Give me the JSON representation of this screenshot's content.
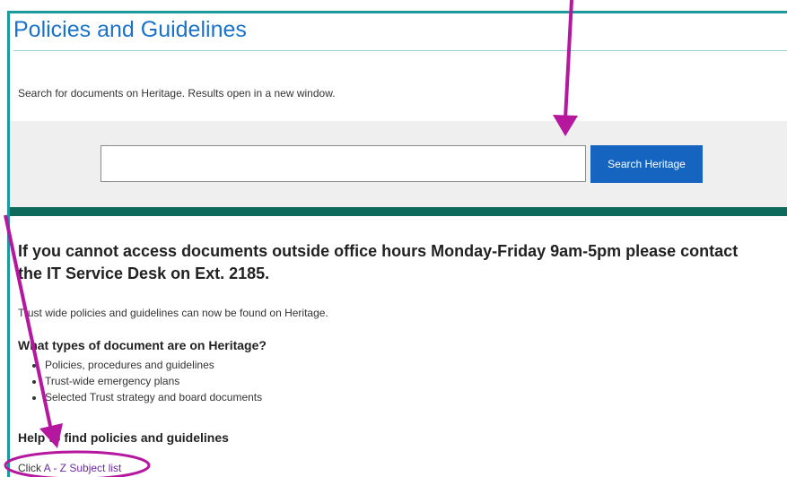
{
  "page": {
    "title": "Policies and Guidelines"
  },
  "search": {
    "intro": "Search for documents on Heritage. Results open in a new window.",
    "input_value": "",
    "button_label": "Search Heritage"
  },
  "content": {
    "notice_heading": "If you cannot access documents outside office hours Monday-Friday 9am-5pm please contact the IT Service Desk on Ext. 2185.",
    "intro_paragraph": "Trust wide policies and guidelines can now be found on Heritage.",
    "doc_types_heading": "What types of document are on Heritage?",
    "doc_types": [
      "Policies, procedures and guidelines",
      "Trust-wide emergency plans",
      "Selected Trust strategy and board documents"
    ],
    "find_heading": "Help to find policies and guidelines",
    "az_prefix": "Click ",
    "az_link": "A - Z Subject list"
  },
  "colors": {
    "frame_border": "#1a9a9a",
    "title": "#1a73c8",
    "search_band": "#efefef",
    "button": "#1565c0",
    "band_rule": "#0e6a5a",
    "link": "#6a2aa0",
    "annotation": "#b5179e"
  }
}
